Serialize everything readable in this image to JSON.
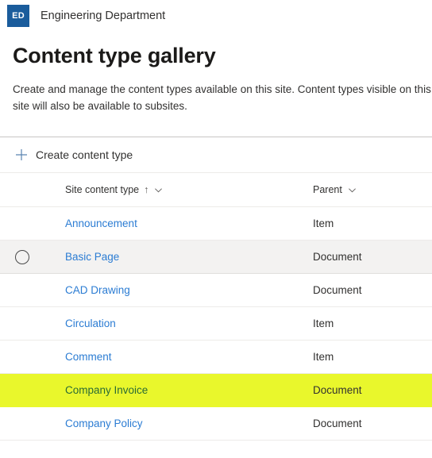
{
  "site": {
    "logo_initials": "ED",
    "logo_color": "#1a5c9c",
    "name": "Engineering Department"
  },
  "page": {
    "title": "Content type gallery",
    "description": "Create and manage the content types available on this site. Content types visible on this site will also be available to subsites."
  },
  "command_bar": {
    "create": {
      "label": "Create content type",
      "icon": "plus-icon"
    }
  },
  "list": {
    "columns": {
      "name": {
        "label": "Site content type",
        "sort_indicator": "↑",
        "menu_icon": "chevron-down-icon"
      },
      "parent": {
        "label": "Parent",
        "menu_icon": "chevron-down-icon"
      }
    },
    "rows": [
      {
        "name": "Announcement",
        "parent": "Item",
        "state": "normal"
      },
      {
        "name": "Basic Page",
        "parent": "Document",
        "state": "hovered"
      },
      {
        "name": "CAD Drawing",
        "parent": "Document",
        "state": "normal"
      },
      {
        "name": "Circulation",
        "parent": "Item",
        "state": "normal"
      },
      {
        "name": "Comment",
        "parent": "Item",
        "state": "normal"
      },
      {
        "name": "Company Invoice",
        "parent": "Document",
        "state": "highlight"
      },
      {
        "name": "Company Policy",
        "parent": "Document",
        "state": "normal"
      }
    ]
  },
  "colors": {
    "link": "#2b7cd3",
    "highlight": "#e9f72c",
    "hover_row": "#f3f2f1",
    "brand": "#1a5c9c"
  }
}
